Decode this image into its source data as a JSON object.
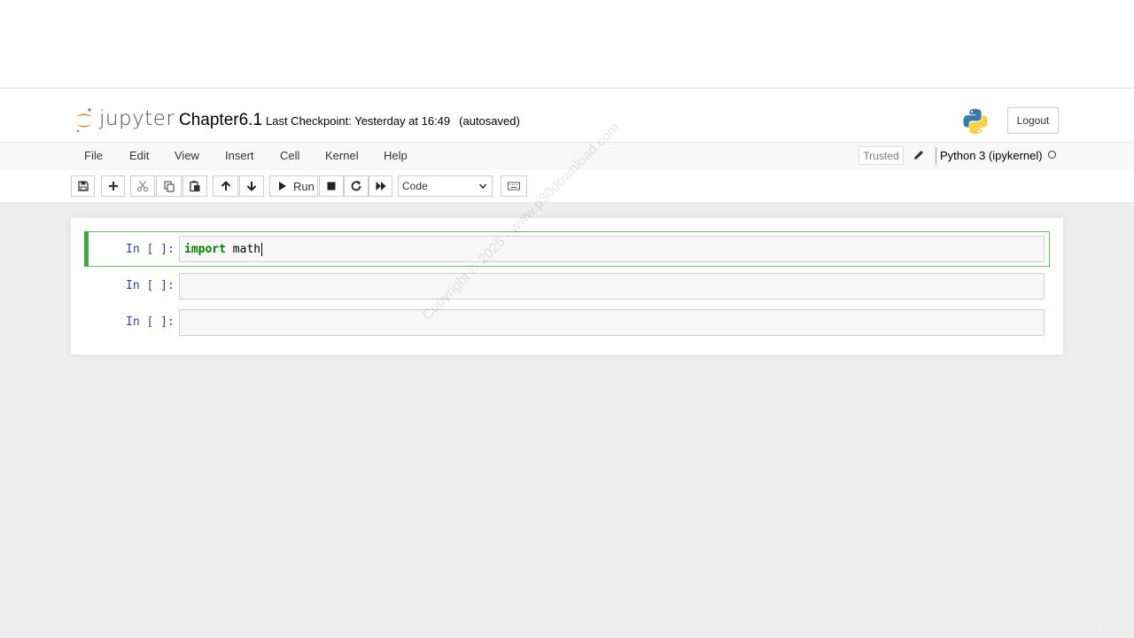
{
  "header": {
    "logo_text": "jupyter",
    "notebook_name": "Chapter6.1",
    "checkpoint_text": "Last Checkpoint: Yesterday at 16:49",
    "autosave_status": "(autosaved)",
    "logout_label": "Logout"
  },
  "menu": {
    "items": [
      "File",
      "Edit",
      "View",
      "Insert",
      "Cell",
      "Kernel",
      "Help"
    ],
    "trusted_label": "Trusted",
    "kernel_name": "Python 3 (ipykernel)"
  },
  "toolbar": {
    "run_label": "Run",
    "cell_type": "Code"
  },
  "cells": [
    {
      "prompt": "In [ ]:",
      "keyword": "import",
      "code_rest": " math",
      "selected": true
    },
    {
      "prompt": "In [ ]:",
      "keyword": "",
      "code_rest": "",
      "selected": false
    },
    {
      "prompt": "In [ ]:",
      "keyword": "",
      "code_rest": "",
      "selected": false
    }
  ],
  "watermark": "Copyright © 2025 - www.p30download.com",
  "branding": "ûdemy",
  "colors": {
    "jupyter_orange": "#f37726",
    "selected_cell_green": "#42a545",
    "prompt_blue": "#303f9f",
    "keyword_green": "#008000"
  }
}
